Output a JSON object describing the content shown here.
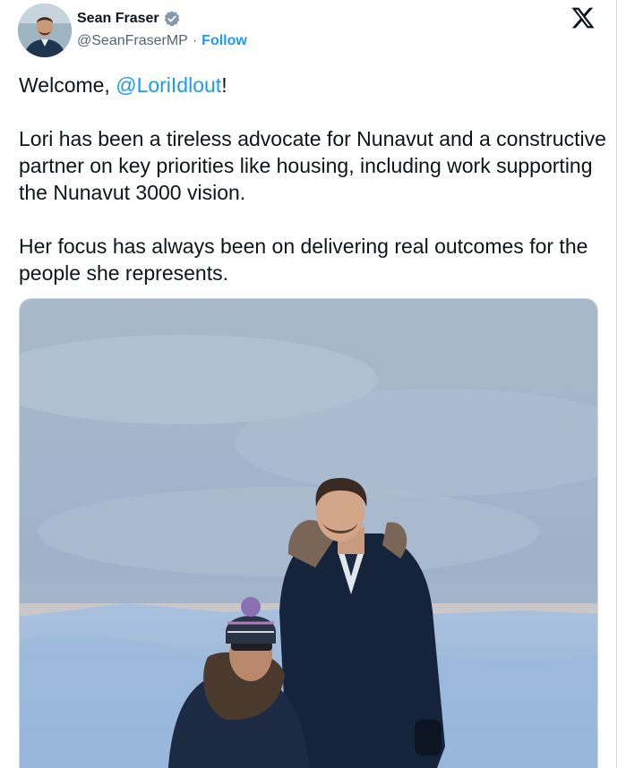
{
  "author": {
    "display_name": "Sean Fraser",
    "handle": "@SeanFraserMP",
    "follow_label": "Follow",
    "verified_icon": "verified-badge-icon",
    "avatar_alt": "avatar"
  },
  "tweet": {
    "line1_prefix": "Welcome, ",
    "line1_mention": "@LoriIdlout",
    "line1_suffix": "!",
    "paragraph2": "Lori has been a tireless advocate for Nunavut and a constructive partner on key priorities like housing, including work supporting the Nunavut 3000 vision.",
    "paragraph3": "Her focus has always been on delivering real outcomes for the people she represents."
  },
  "colors": {
    "link": "#1d9bf0",
    "text": "#0f1419",
    "secondary": "#536471"
  },
  "icons": {
    "close": "x-logo-icon"
  }
}
